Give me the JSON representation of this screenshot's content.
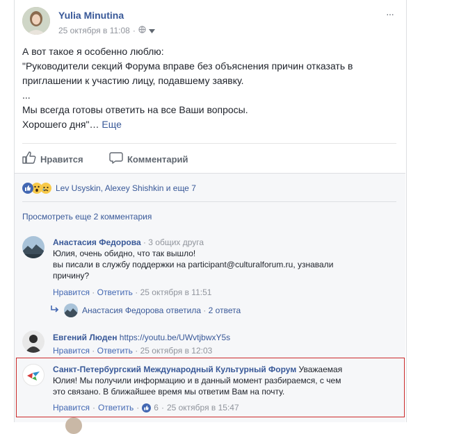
{
  "post": {
    "author": "Yulia Minutina",
    "timestamp": "25 октября в 11:08",
    "menu_glyph": "···",
    "privacy_icon": "globe-icon",
    "text_lines": [
      "А вот такое я особенно люблю:",
      "\"Руководители секций Форума вправе без объяснения причин отказать в",
      "приглашении к участию лицу, подавшему заявку.",
      "...",
      "Мы всегда готовы ответить на все Ваши вопросы.",
      "Хорошего дня\"…"
    ],
    "more_link": "Еще"
  },
  "actions": {
    "like": "Нравится",
    "comment": "Комментарий"
  },
  "reactions": {
    "summary": "Lev Usyskin, Alexey Shishkin и еще 7",
    "icons": [
      "like-icon",
      "wow-icon",
      "sad-icon"
    ]
  },
  "view_more": "Просмотреть еще 2 комментария",
  "comments": [
    {
      "author": "Анастасия Федорова",
      "context": " · 3 общих друга",
      "text_lines": [
        "Юлия, очень обидно, что так вышло!",
        "вы писали в службу поддержки на participant@culturalforum.ru, узнавали",
        "причину?"
      ],
      "like": "Нравится",
      "reply": "Ответить",
      "time": "25 октября в 11:51"
    },
    {
      "author": "Евгений Люден",
      "text": "https://youtu.be/UWvtjbwxY5s",
      "like": "Нравится",
      "reply": "Ответить",
      "time": "25 октября в 12:03"
    },
    {
      "author": "Санкт-Петербургский Международный Культурный Форум",
      "text_first": " Уважаемая",
      "text_lines": [
        "Юлия! Мы получили информацию и в данный момент разбираемся, с чем",
        "это связано. В ближайшее время мы ответим Вам на почту."
      ],
      "like": "Нравится",
      "reply": "Ответить",
      "like_count": "6",
      "time": "25 октября в 15:47"
    }
  ],
  "reply_summary": {
    "author": "Анастасия Федорова",
    "action": " ответила",
    "count": "2 ответа"
  },
  "colors": {
    "link": "#385898",
    "highlight_border": "#cc2a2a",
    "muted": "#90949c",
    "like_blue": "#4267b2"
  }
}
